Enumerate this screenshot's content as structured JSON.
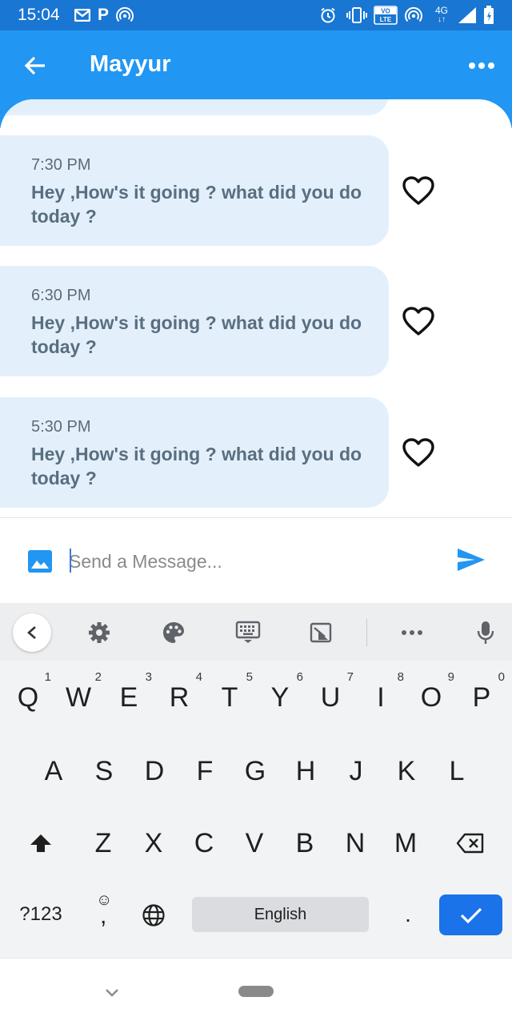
{
  "status_bar": {
    "time": "15:04",
    "network_label": "4G",
    "volte_label": "VO LTE"
  },
  "header": {
    "title": "Mayyur",
    "color": "#2196F3"
  },
  "messages": [
    {
      "time": "7:30 PM",
      "text": "Hey ,How's it going ? what did you do today ?",
      "liked": false
    },
    {
      "time": "6:30 PM",
      "text": "Hey ,How's it going ? what did you do today ?",
      "liked": false
    },
    {
      "time": "5:30 PM",
      "text": "Hey ,How's it going ? what did you do today ?",
      "liked": false
    }
  ],
  "composer": {
    "placeholder": "Send a Message...",
    "value": ""
  },
  "keyboard": {
    "row1": [
      {
        "key": "Q",
        "hint": "1"
      },
      {
        "key": "W",
        "hint": "2"
      },
      {
        "key": "E",
        "hint": "3"
      },
      {
        "key": "R",
        "hint": "4"
      },
      {
        "key": "T",
        "hint": "5"
      },
      {
        "key": "Y",
        "hint": "6"
      },
      {
        "key": "U",
        "hint": "7"
      },
      {
        "key": "I",
        "hint": "8"
      },
      {
        "key": "O",
        "hint": "9"
      },
      {
        "key": "P",
        "hint": "0"
      }
    ],
    "row2": [
      "A",
      "S",
      "D",
      "F",
      "G",
      "H",
      "J",
      "K",
      "L"
    ],
    "row3": [
      "Z",
      "X",
      "C",
      "V",
      "B",
      "N",
      "M"
    ],
    "symbols_label": "?123",
    "emoji_label": "☺",
    "comma_label": ",",
    "space_label": "English",
    "period_label": "."
  }
}
